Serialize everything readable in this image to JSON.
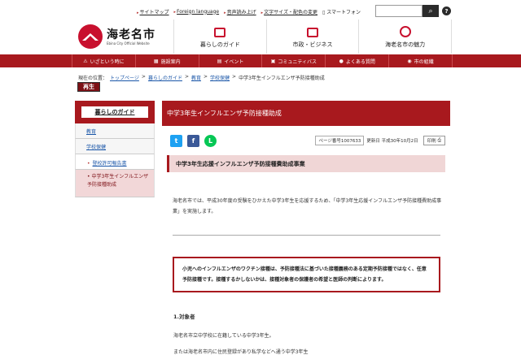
{
  "utility": {
    "links": [
      "サイトマップ",
      "Foreign language",
      "音声読み上げ",
      "文字サイズ・配色の変更"
    ],
    "phone": "スマートフォン",
    "search_placeholder": "",
    "help": "?"
  },
  "logo": {
    "name": "海老名市",
    "sub": "Ebina City Official Website"
  },
  "main_nav": [
    {
      "label": "暮らしのガイド",
      "icon": "house-icon"
    },
    {
      "label": "市政・ビジネス",
      "icon": "building-icon"
    },
    {
      "label": "海老名市の魅力",
      "icon": "character-icon"
    }
  ],
  "red_menu": [
    {
      "label": "いざという時に",
      "icon": "warning-icon"
    },
    {
      "label": "施設案内",
      "icon": "facility-icon"
    },
    {
      "label": "イベント",
      "icon": "calendar-icon"
    },
    {
      "label": "コミュニティバス",
      "icon": "bus-icon"
    },
    {
      "label": "よくある質問",
      "icon": "question-icon"
    },
    {
      "label": "市の組織",
      "icon": "org-icon"
    }
  ],
  "breadcrumb": {
    "prefix": "現在の位置：",
    "items": [
      "トップページ",
      "暮らしのガイド",
      "教育",
      "学校保健"
    ],
    "current": "中学3年生インフルエンザ予防接種助成",
    "separator": ">"
  },
  "play_badge": "再生",
  "sidebar": {
    "heading": "暮らしのガイド",
    "items": [
      {
        "label": "教育"
      },
      {
        "label": "学校保健"
      },
      {
        "label": "登校許可報告書"
      },
      {
        "label": "中学3年生インフルエンザ予防接種助成"
      }
    ]
  },
  "content": {
    "title": "中学3年生インフルエンザ予防接種助成",
    "share": {
      "twitter": "t",
      "facebook": "f",
      "line": "L"
    },
    "page_number": "ページ番号1007633",
    "updated": "更新日  平成30年10月2日",
    "print": "印刷",
    "section_title": "中学3年生応援インフルエンザ予防接種費助成事業",
    "intro": "海老名市では、平成30年度の受験をひかえた中学3年生を応援するため、「中学3年生応援インフルエンザ予防接種費助成事業」を実施します。",
    "notice": "小児へのインフルエンザのワクチン接種は、予防接種法に基づいた接種義務のある定期予防接種ではなく、任意予防接種です。接種するかしないかは、接種対象者の保護者の希望と医師の判断によります。",
    "heading_target": "1.対象者",
    "target_line1": "海老名市立中学校に在籍している中学3年生。",
    "target_line2": "または海老名市内に住民登録があり私学などへ通う中学3年生"
  },
  "colors": {
    "brand_red": "#a8191e",
    "section_bg": "#f0d6d6",
    "link": "#1a56a8"
  }
}
